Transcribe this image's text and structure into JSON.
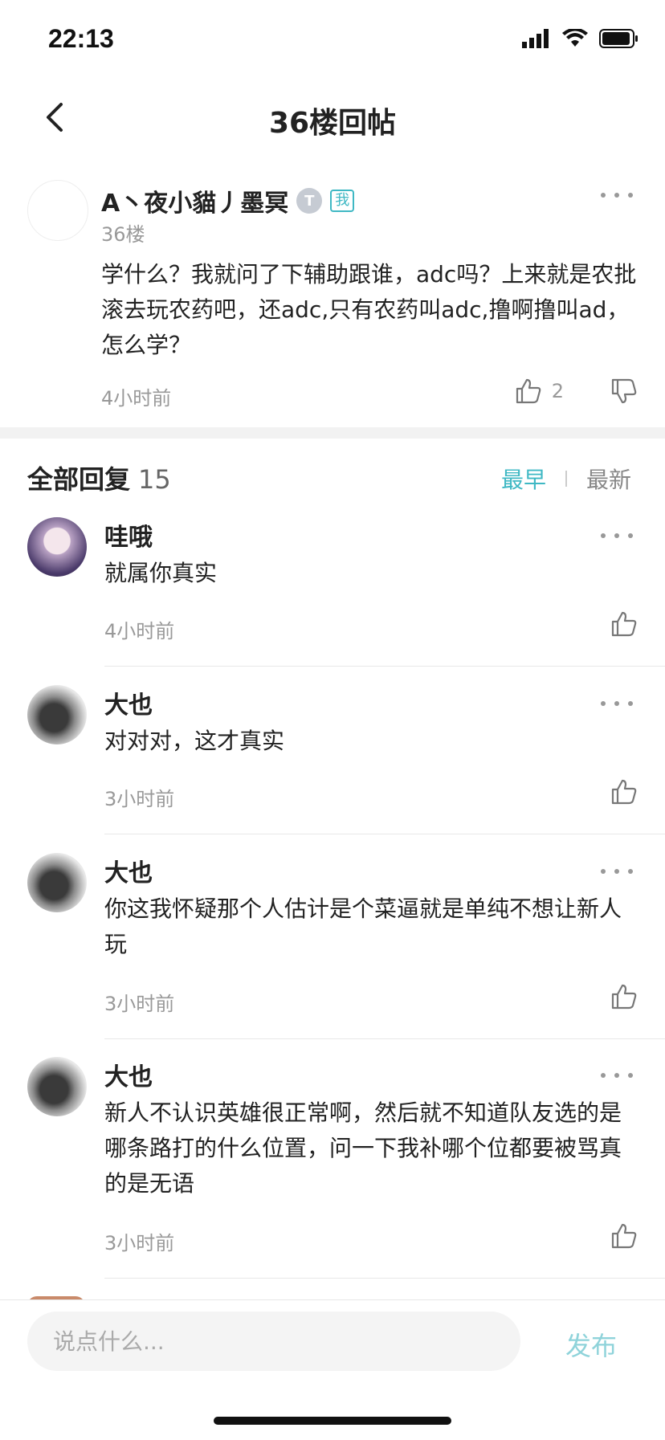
{
  "status_bar": {
    "time": "22:13"
  },
  "nav": {
    "title": "36楼回帖"
  },
  "main_post": {
    "author": "A丶夜小貓丿墨冥",
    "level_badge": "T",
    "me_badge": "我",
    "floor": "36楼",
    "content": "学什么？我就问了下辅助跟谁，adc吗？上来就是农批滚去玩农药吧，还adc,只有农药叫adc,撸啊撸叫ad，怎么学？",
    "time": "4小时前",
    "like_count": "2"
  },
  "replies_header": {
    "title": "全部回复",
    "count": "15",
    "sort_earliest": "最早",
    "sort_latest": "最新"
  },
  "replies": [
    {
      "author": "哇哦",
      "content": "就属你真实",
      "time": "4小时前"
    },
    {
      "author": "大也",
      "content": "对对对，这才真实",
      "time": "3小时前"
    },
    {
      "author": "大也",
      "content": "你这我怀疑那个人估计是个菜逼就是单纯不想让新人玩",
      "time": "3小时前"
    },
    {
      "author": "大也",
      "content": "新人不认识英雄很正常啊，然后就不知道队友选的是哪条路打的什么位置，问一下我补哪个位都要被骂真的是无语",
      "time": "3小时前"
    }
  ],
  "bottom_bar": {
    "input_placeholder": "说点什么...",
    "publish_label": "发布"
  },
  "colors": {
    "accent": "#3fb8c4",
    "publish": "#8fd3da",
    "muted": "#999999"
  }
}
